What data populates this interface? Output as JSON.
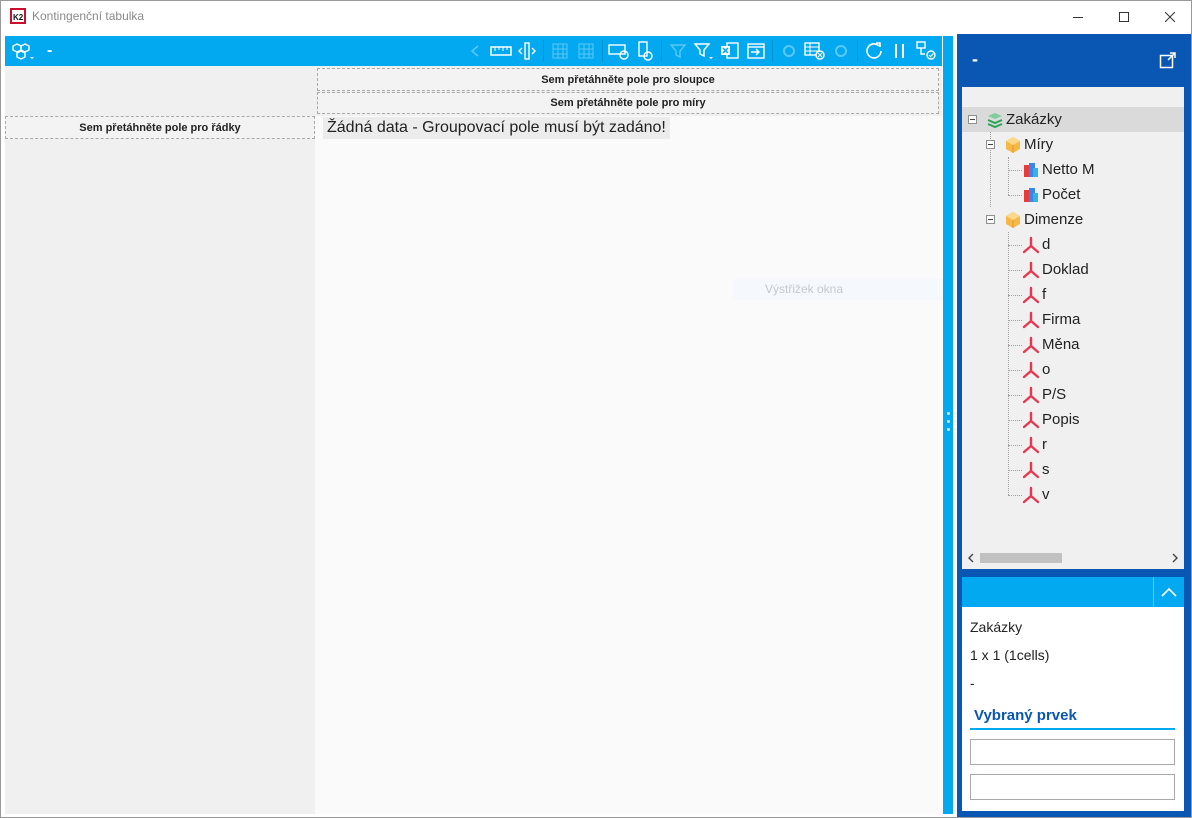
{
  "window": {
    "title": "Kontingenční tabulka",
    "accent": "#03a9f0",
    "panel_blue": "#0a56b3"
  },
  "toolbar": {
    "cube_label": "-",
    "icons": [
      "ruler-icon",
      "column-resize-icon",
      "grid-icon",
      "grid-icon",
      "table-filter-icon",
      "table-sort-icon",
      "filter-icon",
      "filter-dropdown-icon",
      "excel-export-icon",
      "window-export-icon",
      "settings-icon",
      "table-remove-icon",
      "refresh-icon",
      "pause-icon",
      "layout-check-icon"
    ]
  },
  "dropzones": {
    "columns": "Sem přetáhněte pole pro sloupce",
    "measures": "Sem přetáhněte pole pro míry",
    "rows": "Sem přetáhněte pole pro řádky"
  },
  "main": {
    "no_data": "Žádná data - Groupovací pole musí být zadáno!",
    "snip_hint": "Výstřižek okna"
  },
  "right_panel": {
    "title": "-",
    "tree": {
      "root": "Zakázky",
      "measures_group": "Míry",
      "measures": [
        "Netto M",
        "Počet"
      ],
      "dimensions_group": "Dimenze",
      "dimensions": [
        "d",
        "Doklad",
        "f",
        "Firma",
        "Měna",
        "o",
        "P/S",
        "Popis",
        "r",
        "s",
        "v"
      ]
    },
    "info": {
      "source": "Zakázky",
      "size": "1 x 1 (1cells)",
      "value": "-",
      "selected_title": "Vybraný prvek"
    }
  }
}
